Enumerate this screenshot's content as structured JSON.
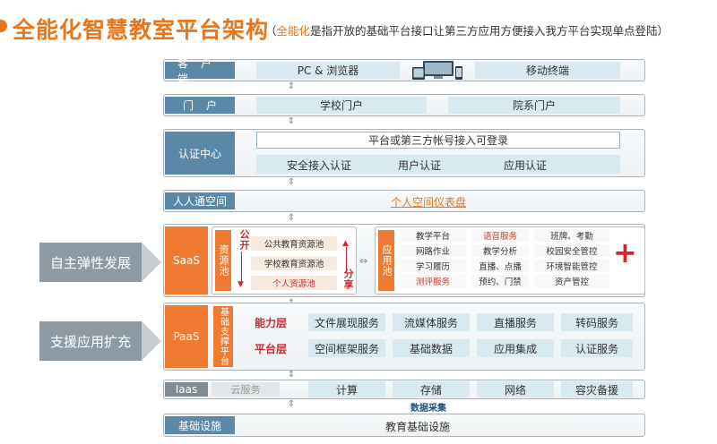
{
  "header": {
    "title": "全能化智慧教室平台架构",
    "subtitle_open": "（",
    "subtitle_highlight": "全能化",
    "subtitle_rest": "是指开放的基础平台接口让第三方应用方便接入我方平台实现单点登陆）"
  },
  "side": {
    "saas_note": "自主弹性发展",
    "paas_note": "支援应用扩充"
  },
  "rows": {
    "client": {
      "label": "客户端",
      "pc": "PC & 浏览器",
      "mobile": "移动终端"
    },
    "portal": {
      "label": "门户",
      "school": "学校门户",
      "dept": "院系门户"
    },
    "auth": {
      "label": "认证中心",
      "third_party": "平台或第三方帐号接入可登录",
      "items": [
        "安全接入认证",
        "用户认证",
        "应用认证"
      ]
    },
    "space": {
      "label": "人人通空间",
      "dashboard": "个人空间仪表盘"
    },
    "saas": {
      "label": "SaaS",
      "resource_pool": "资源池",
      "open_label": "公开",
      "share_label": "分享",
      "resources": [
        "公共教育资源池",
        "学校教育资源池",
        "个人资源池"
      ],
      "app_pool": "应用池",
      "apps": [
        [
          "教学平台",
          "语音服务",
          "班牌、考勤"
        ],
        [
          "网路作业",
          "教学分析",
          "校园安全管控"
        ],
        [
          "学习履历",
          "直播、点播",
          "环境智能管控"
        ],
        [
          "测评服务",
          "预约、门禁",
          "资产管控"
        ]
      ],
      "plus": "+"
    },
    "paas": {
      "label": "PaaS",
      "support": "基础支撑平台",
      "capability_label": "能力层",
      "capability": [
        "文件展现服务",
        "流媒体服务",
        "直播服务",
        "转码服务"
      ],
      "platform_label": "平台层",
      "platform": [
        "空间框架服务",
        "基础数据",
        "应用集成",
        "认证服务"
      ]
    },
    "iaas": {
      "label": "Iaas",
      "cloud": "云服务",
      "items": [
        "计算",
        "存储",
        "网络",
        "容灾备援"
      ],
      "data_collect": "数据采集"
    },
    "infra": {
      "label": "基础设施",
      "content": "教育基础设施"
    }
  },
  "colors": {
    "accent": "#e8761c",
    "label_blue": "#5c88a8",
    "cell": "#d8e9ef",
    "red": "#c9282d"
  }
}
